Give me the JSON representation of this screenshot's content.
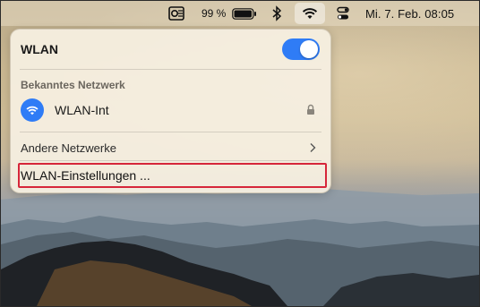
{
  "menubar": {
    "battery_percent": "99 %",
    "clock": "Mi. 7. Feb. 08:05",
    "icons": [
      "outlook-icon",
      "battery-icon",
      "bluetooth-icon",
      "wifi-icon",
      "control-center-icon"
    ]
  },
  "wlan_panel": {
    "title": "WLAN",
    "toggle_on": true,
    "known_network_header": "Bekanntes Netzwerk",
    "known_network": {
      "name": "WLAN-Int",
      "secured": true
    },
    "other_networks_label": "Andere Netzwerke",
    "settings_label": "WLAN-Einstellungen ..."
  },
  "colors": {
    "accent": "#2f7cf6",
    "highlight_border": "#d6263a"
  }
}
